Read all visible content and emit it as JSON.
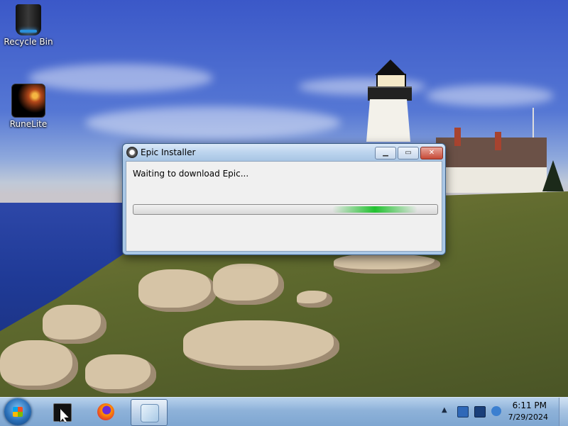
{
  "desktop": {
    "icons": [
      {
        "label": "Recycle Bin",
        "icon": "recycle-bin-icon"
      },
      {
        "label": "RuneLite",
        "icon": "runelite-icon"
      }
    ]
  },
  "window": {
    "title": "Epic Installer",
    "icon": "epic-installer-icon",
    "status_text": "Waiting to download Epic...",
    "progress_style": "indeterminate-marquee",
    "buttons": {
      "minimize": "minimize-icon",
      "maximize": "maximize-icon",
      "close": "close-icon"
    }
  },
  "taskbar": {
    "start": "windows-start-icon",
    "pinned": [
      {
        "name": "command-prompt",
        "icon": "cmd-icon",
        "active": false
      },
      {
        "name": "firefox",
        "icon": "firefox-icon",
        "active": false
      },
      {
        "name": "epic-installer",
        "icon": "installer-icon",
        "active": true
      }
    ],
    "tray": {
      "overflow_glyph": "▲",
      "icons": [
        "network-icon",
        "display-icon",
        "volume-icon"
      ],
      "time": "6:11 PM",
      "date": "7/29/2024"
    }
  },
  "colors": {
    "progress_glow": "#22c230",
    "close_button": "#c64a36",
    "taskbar": "#8eb2d9"
  }
}
